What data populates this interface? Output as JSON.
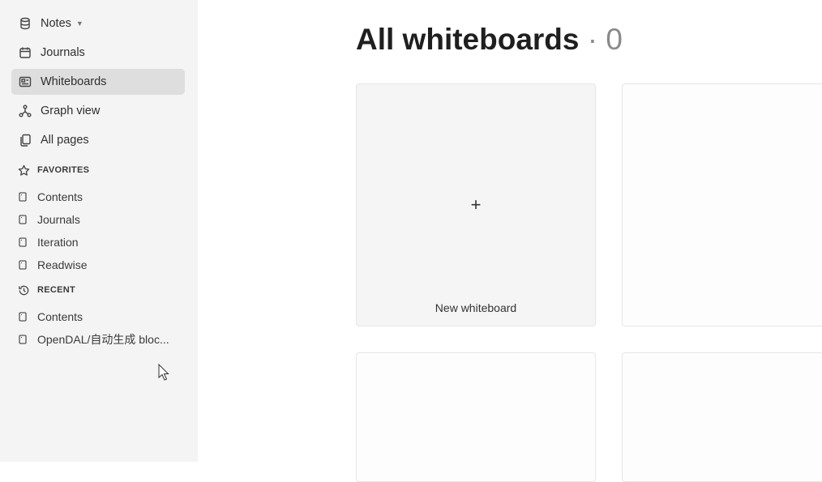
{
  "sidebar": {
    "nav": [
      {
        "label": "Notes",
        "icon": "database-icon"
      },
      {
        "label": "Journals",
        "icon": "calendar-icon"
      },
      {
        "label": "Whiteboards",
        "icon": "whiteboard-icon"
      },
      {
        "label": "Graph view",
        "icon": "graph-icon"
      },
      {
        "label": "All pages",
        "icon": "pages-icon"
      }
    ],
    "favorites": {
      "title": "FAVORITES",
      "items": [
        {
          "label": "Contents"
        },
        {
          "label": "Journals"
        },
        {
          "label": "Iteration"
        },
        {
          "label": "Readwise"
        }
      ]
    },
    "recent": {
      "title": "RECENT",
      "items": [
        {
          "label": "Contents"
        },
        {
          "label": "OpenDAL/自动生成 bloc..."
        }
      ]
    }
  },
  "main": {
    "title": "All whiteboards",
    "separator": "·",
    "count": "0",
    "new_card": {
      "plus": "+",
      "label": "New whiteboard"
    }
  },
  "colors": {
    "sidebar_bg": "#f4f4f4",
    "active_item_bg": "#dedede",
    "card_bg": "#f5f5f5"
  }
}
